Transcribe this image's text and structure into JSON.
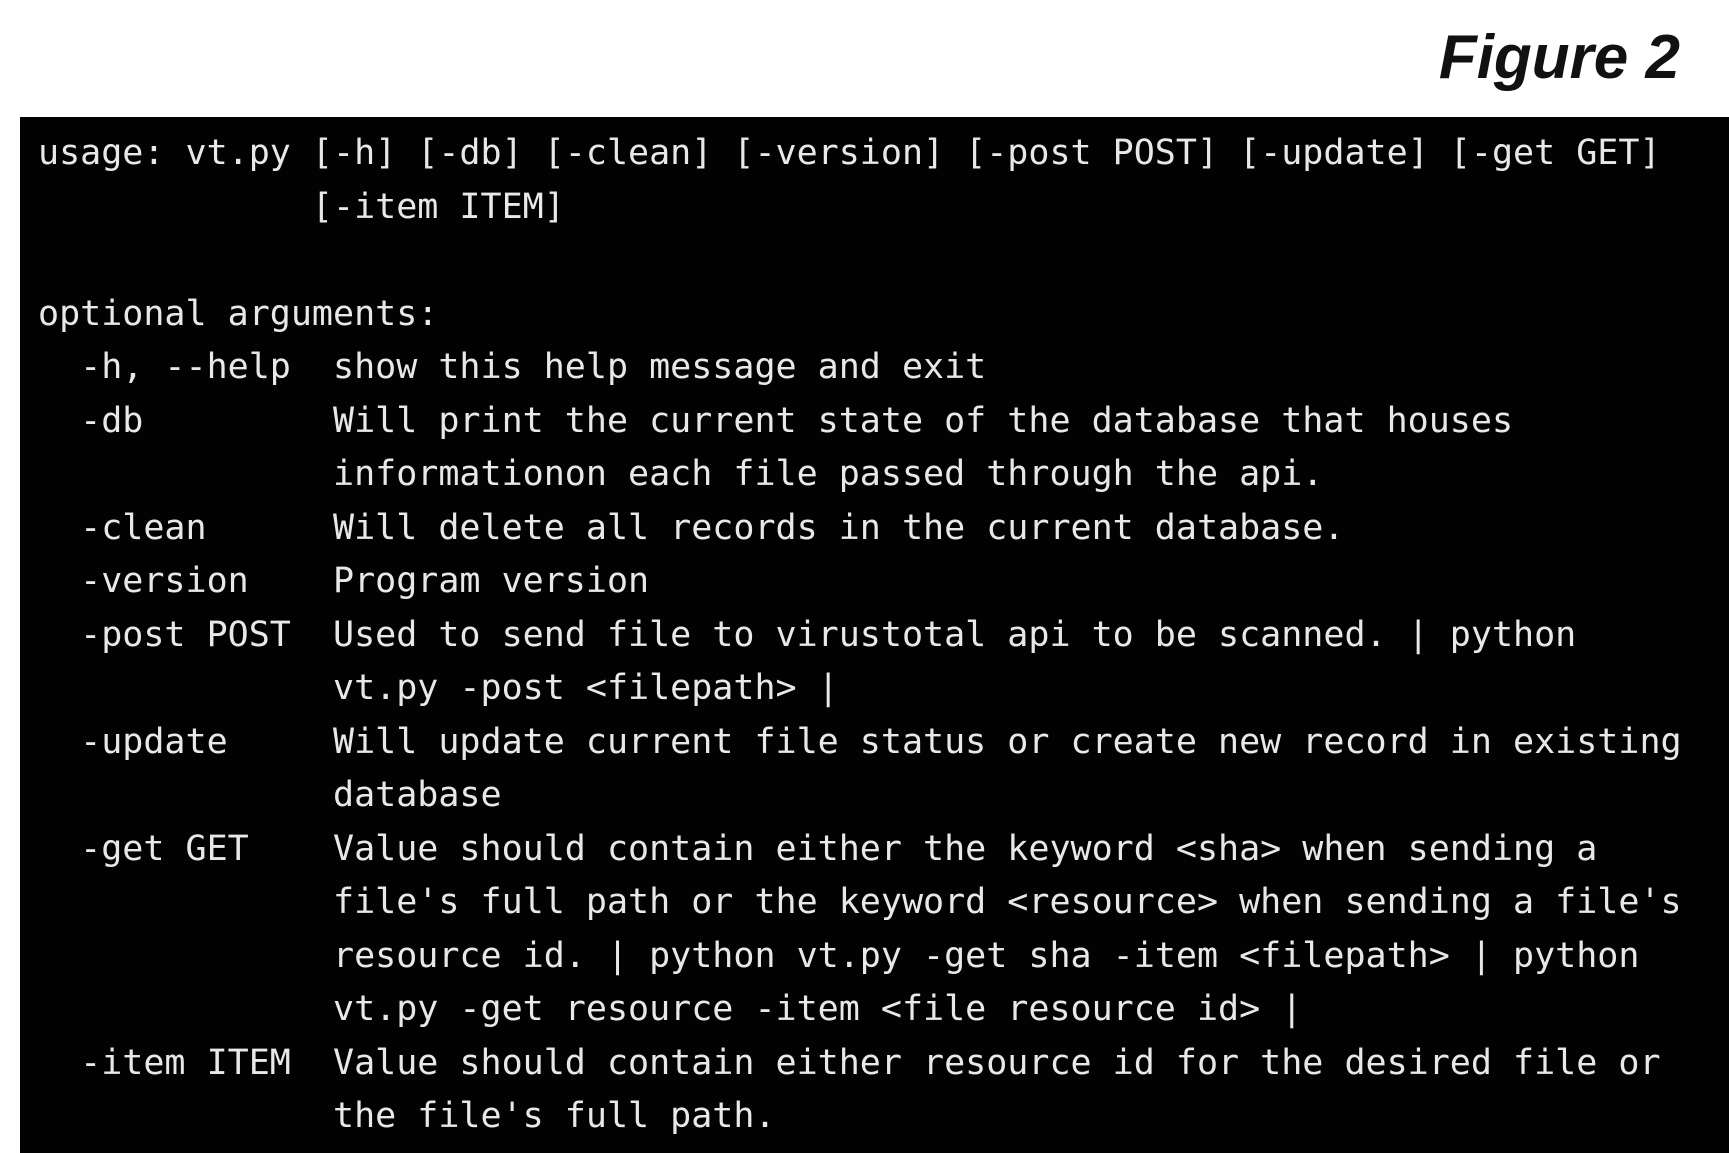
{
  "figure": {
    "label": "Figure 2"
  },
  "terminal": {
    "lines": [
      "usage: vt.py [-h] [-db] [-clean] [-version] [-post POST] [-update] [-get GET]",
      "             [-item ITEM]",
      "",
      "optional arguments:",
      "  -h, --help  show this help message and exit",
      "  -db         Will print the current state of the database that houses",
      "              informationon each file passed through the api.",
      "  -clean      Will delete all records in the current database.",
      "  -version    Program version",
      "  -post POST  Used to send file to virustotal api to be scanned. | python",
      "              vt.py -post <filepath> |",
      "  -update     Will update current file status or create new record in existing",
      "              database",
      "  -get GET    Value should contain either the keyword <sha> when sending a",
      "              file's full path or the keyword <resource> when sending a file's",
      "              resource id. | python vt.py -get sha -item <filepath> | python",
      "              vt.py -get resource -item <file resource id> |",
      "  -item ITEM  Value should contain either resource id for the desired file or",
      "              the file's full path."
    ]
  }
}
